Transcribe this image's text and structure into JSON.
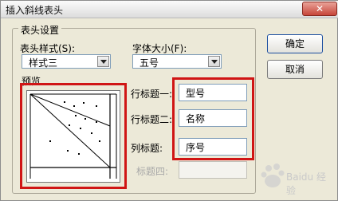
{
  "window": {
    "title": "插入斜线表头",
    "close_glyph": "✕"
  },
  "group": {
    "title": "表头设置",
    "style_label": "表头样式(S):",
    "style_value": "样式三",
    "fontsize_label": "字体大小(F):",
    "fontsize_value": "五号",
    "preview_label": "预览"
  },
  "titles": [
    {
      "label": "行标题一:",
      "value": "型号"
    },
    {
      "label": "行标题二:",
      "value": "名称"
    },
    {
      "label": "列标题:",
      "value": "序号"
    },
    {
      "label": "标题四:",
      "value": ""
    }
  ],
  "buttons": {
    "ok": "确定",
    "cancel": "取消"
  },
  "watermark": "Baidu 经验",
  "colors": {
    "highlight": "#d01515",
    "dialog_bg": "#ECE9D8"
  }
}
